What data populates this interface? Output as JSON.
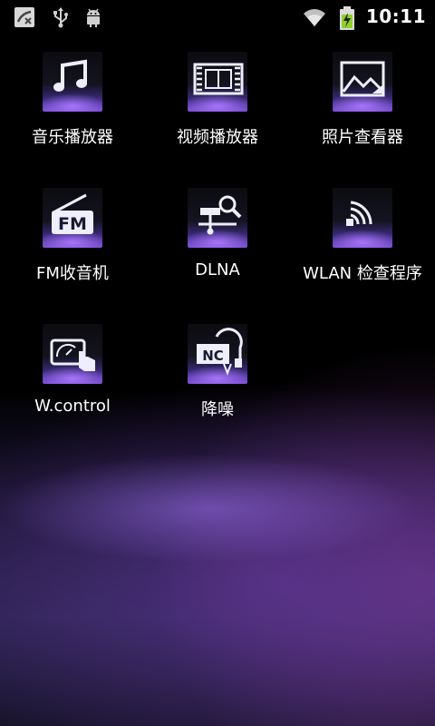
{
  "status_bar": {
    "time": "10:11",
    "left_icons": [
      "missed-call-icon",
      "usb-icon",
      "android-debug-icon"
    ],
    "right_icons": [
      "wifi-icon",
      "battery-charging-icon"
    ]
  },
  "apps": [
    {
      "label": "音乐播放器",
      "icon": "music-note-icon"
    },
    {
      "label": "视频播放器",
      "icon": "film-strip-icon"
    },
    {
      "label": "照片查看器",
      "icon": "photo-icon"
    },
    {
      "label": "FM收音机",
      "icon": "fm-radio-icon"
    },
    {
      "label": "DLNA",
      "icon": "dlna-network-icon"
    },
    {
      "label": "WLAN 检查程序",
      "icon": "wlan-signal-icon"
    },
    {
      "label": "W.control",
      "icon": "touch-control-icon"
    },
    {
      "label": "降噪",
      "icon": "noise-cancel-icon"
    }
  ]
}
